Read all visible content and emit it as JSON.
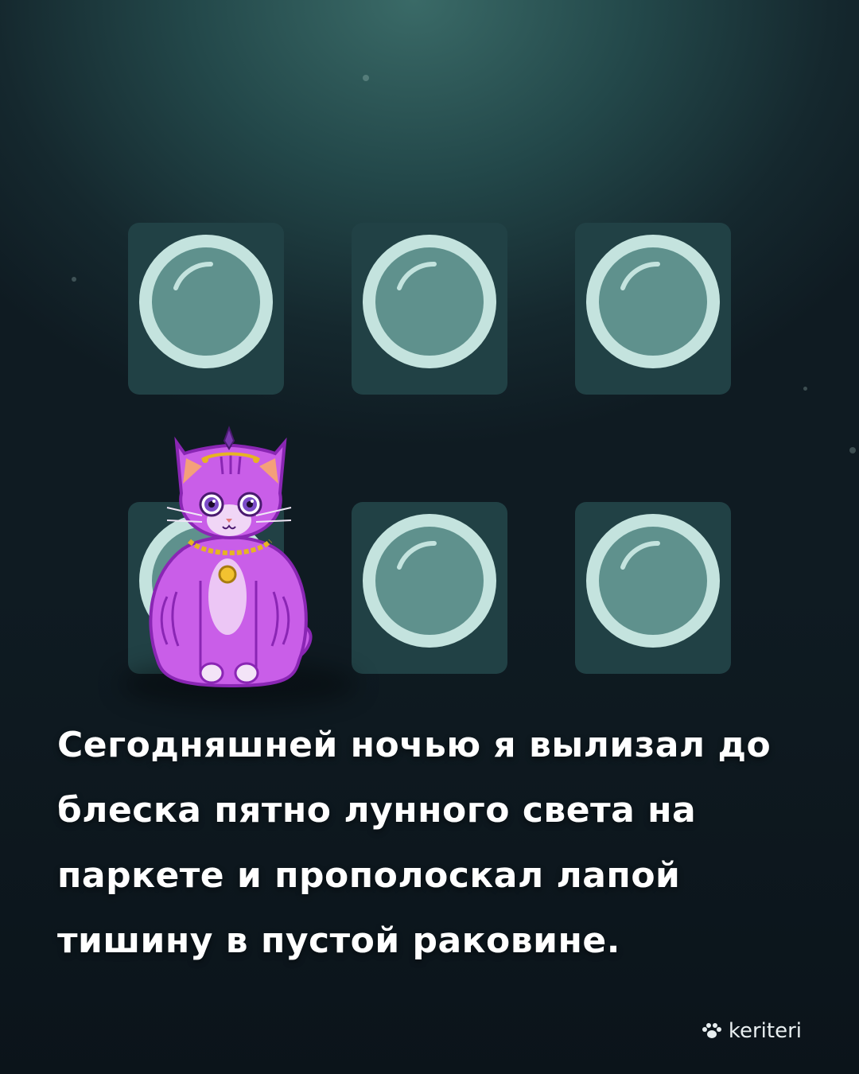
{
  "caption": {
    "lines": [
      "Сегодняшней ночью я вылизал до",
      "блеска пятно лунного света на",
      "паркете и прополоскал лапой",
      "тишину в пустой раковине."
    ]
  },
  "brand": {
    "name": "keriteri",
    "icon": "paw-icon"
  },
  "tiles": [
    {
      "row": 1,
      "col": 1
    },
    {
      "row": 1,
      "col": 2
    },
    {
      "row": 1,
      "col": 3
    },
    {
      "row": 2,
      "col": 1
    },
    {
      "row": 2,
      "col": 2
    },
    {
      "row": 2,
      "col": 3
    }
  ],
  "colors": {
    "tile": "#214145",
    "ring": "#c4e3de",
    "lens": "#5f918d",
    "cat": "#c95ee8",
    "cat_outline": "#8a26b4",
    "text": "#ffffff"
  }
}
